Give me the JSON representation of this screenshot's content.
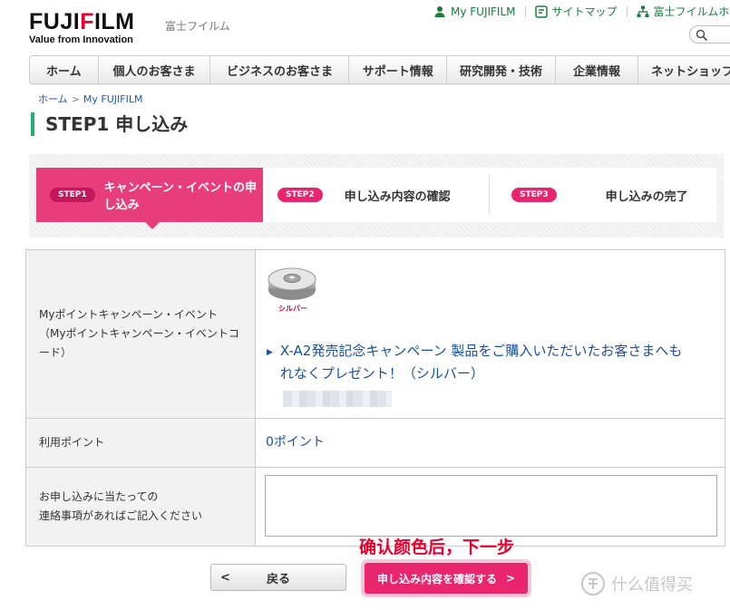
{
  "header": {
    "logo_text": "FUJIFILM",
    "tagline": "Value from Innovation",
    "company_jp": "富士フイルム",
    "links": [
      {
        "icon": "person-icon",
        "label": "My FUJIFILM"
      },
      {
        "icon": "sitemap-icon",
        "label": "サイトマップ"
      },
      {
        "icon": "org-chart-icon",
        "label": "富士フイルムホーム"
      }
    ],
    "search_icon": "search-icon"
  },
  "nav": {
    "items": [
      "ホーム",
      "個人のお客さま",
      "ビジネスのお客さま",
      "サポート情報",
      "研究開発・技術",
      "企業情報",
      "ネットショップ"
    ]
  },
  "breadcrumb": {
    "home": "ホーム",
    "separator": ">",
    "current": "My FUJIFILM"
  },
  "page_title": "STEP1 申し込み",
  "steps": [
    {
      "badge": "STEP1",
      "label": "キャンペーン・イベントの申し込み",
      "active": true
    },
    {
      "badge": "STEP2",
      "label": "申し込み内容の確認",
      "active": false
    },
    {
      "badge": "STEP3",
      "label": "申し込みの完了",
      "active": false
    }
  ],
  "form": {
    "campaign_label": "Myポイントキャンペーン・イベント\n（Myポイントキャンペーン・イベントコード）",
    "campaign_image_caption": "シルバー",
    "campaign_link": "X-A2発売記念キャンペーン 製品をご購入いただいたお客さまへもれなくプレゼント！（シルバー）",
    "points_label": "利用ポイント",
    "points_value": "0ポイント",
    "remarks_label": "お申し込みに当たっての\n連絡事項があればご記入ください",
    "remarks_value": ""
  },
  "annotation": "确认颜色后，下一步",
  "buttons": {
    "back_label": "戻る",
    "back_icon": "<",
    "next_label": "申し込み内容を確認する",
    "next_icon": ">"
  },
  "watermark": {
    "text": "什么值得买",
    "icon": "zhi-logo-icon"
  },
  "colors": {
    "accent_pink": "#e8256d",
    "active_step": "#e83d7b",
    "link_blue": "#1a4f9c",
    "green": "#1a7d3c",
    "annotation_red": "#e6002d",
    "title_bar_green": "#27b06b"
  }
}
